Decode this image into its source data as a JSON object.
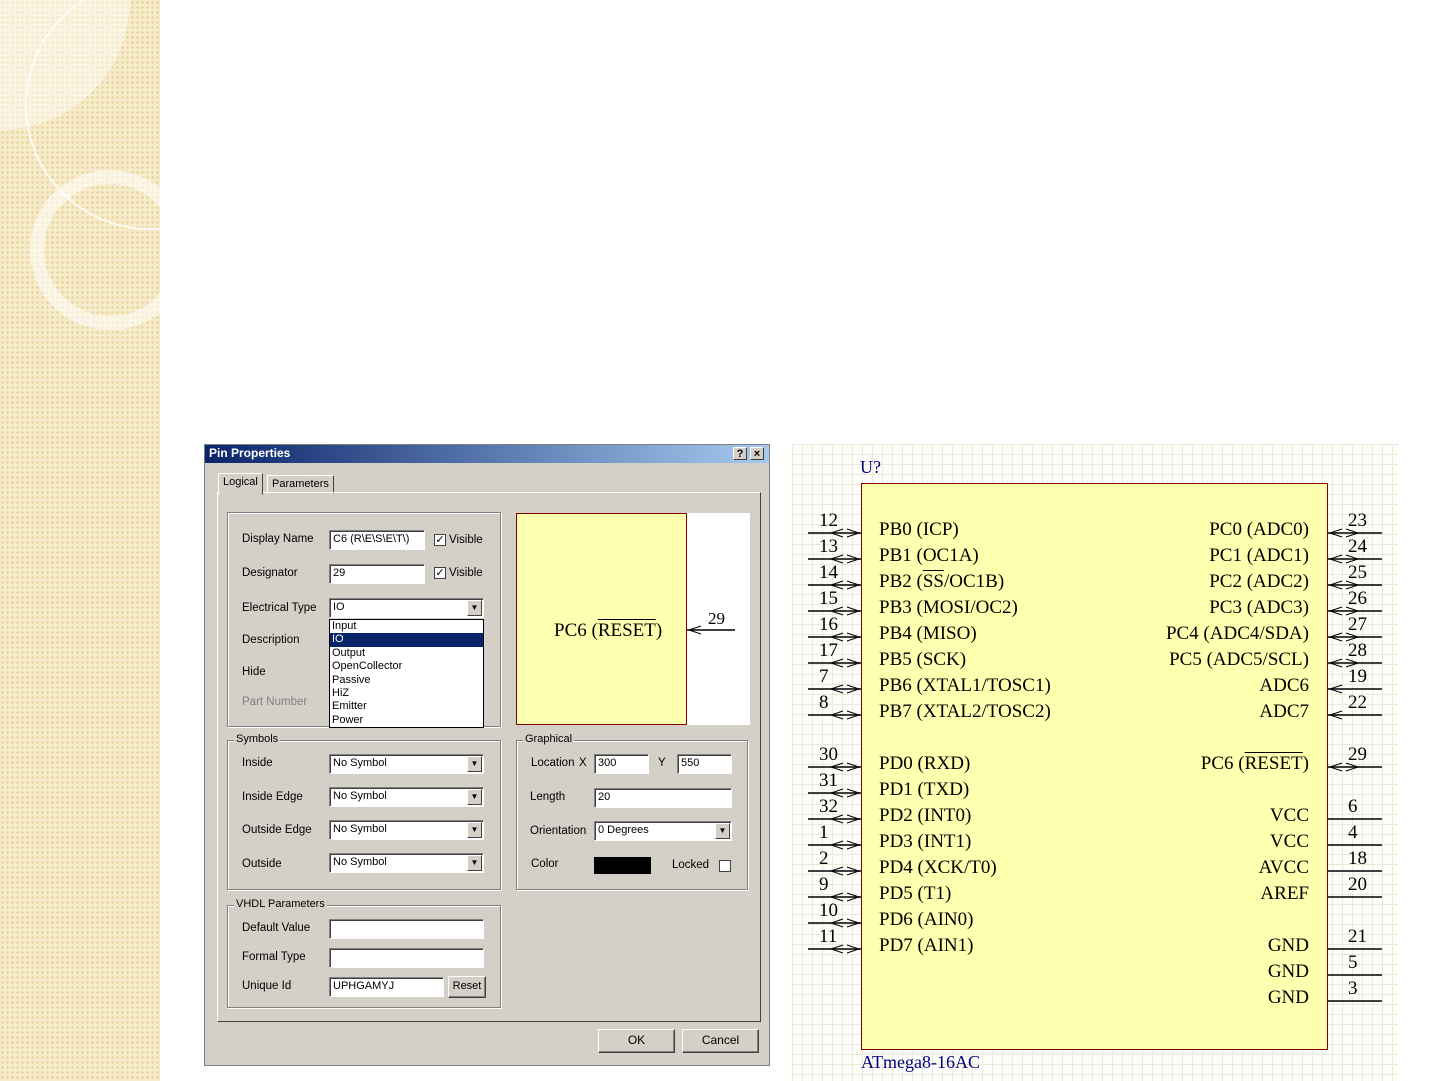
{
  "dialog": {
    "title": "Pin Properties",
    "help_glyph": "?",
    "close_glyph": "×",
    "tabs": [
      "Logical",
      "Parameters"
    ],
    "logical": {
      "display_name_label": "Display Name",
      "display_name_value": "C6 (R\\E\\S\\E\\T\\)",
      "visible_label": "Visible",
      "designator_label": "Designator",
      "designator_value": "29",
      "electrical_type_label": "Electrical Type",
      "electrical_type_value": "IO",
      "description_label": "Description",
      "hide_label": "Hide",
      "part_number_label": "Part Number",
      "electrical_type_options": [
        "Input",
        "IO",
        "Output",
        "OpenCollector",
        "Passive",
        "HiZ",
        "Emitter",
        "Power"
      ],
      "selected_option": "IO"
    },
    "preview": {
      "pin_name": "PC6 (",
      "pin_name_overline": "RESET",
      "pin_name_end": ")",
      "pin_number": "29"
    },
    "symbols": {
      "group_label": "Symbols",
      "inside_label": "Inside",
      "inside_value": "No Symbol",
      "inside_edge_label": "Inside Edge",
      "inside_edge_value": "No Symbol",
      "outside_edge_label": "Outside Edge",
      "outside_edge_value": "No Symbol",
      "outside_label": "Outside",
      "outside_value": "No Symbol"
    },
    "graphical": {
      "group_label": "Graphical",
      "location_label": "Location",
      "x_label": "X",
      "x_value": "300",
      "y_label": "Y",
      "y_value": "550",
      "length_label": "Length",
      "length_value": "20",
      "orientation_label": "Orientation",
      "orientation_value": "0 Degrees",
      "color_label": "Color",
      "color_value": "#000000",
      "locked_label": "Locked"
    },
    "vhdl": {
      "group_label": "VHDL Parameters",
      "default_value_label": "Default Value",
      "default_value": "",
      "formal_type_label": "Formal Type",
      "formal_type": "",
      "unique_id_label": "Unique Id",
      "unique_id_value": "UPHGAMYJ",
      "reset_label": "Reset"
    },
    "ok_label": "OK",
    "cancel_label": "Cancel"
  },
  "schematic": {
    "designator": "U?",
    "part_name": "ATmega8-16AC",
    "body_color": "#ffffb0",
    "left_pins": [
      {
        "num": "12",
        "name": "PB0 (ICP)"
      },
      {
        "num": "13",
        "name": "PB1 (OC1A)"
      },
      {
        "num": "14",
        "name": "PB2 (SS/OC1B)"
      },
      {
        "num": "15",
        "name": "PB3 (MOSI/OC2)"
      },
      {
        "num": "16",
        "name": "PB4 (MISO)"
      },
      {
        "num": "17",
        "name": "PB5 (SCK)"
      },
      {
        "num": "7",
        "name": "PB6 (XTAL1/TOSC1)"
      },
      {
        "num": "8",
        "name": "PB7 (XTAL2/TOSC2)"
      },
      {
        "num": "30",
        "name": "PD0 (RXD)"
      },
      {
        "num": "31",
        "name": "PD1 (TXD)"
      },
      {
        "num": "32",
        "name": "PD2 (INT0)"
      },
      {
        "num": "1",
        "name": "PD3 (INT1)"
      },
      {
        "num": "2",
        "name": "PD4 (XCK/T0)"
      },
      {
        "num": "9",
        "name": "PD5 (T1)"
      },
      {
        "num": "10",
        "name": "PD6 (AIN0)"
      },
      {
        "num": "11",
        "name": "PD7 (AIN1)"
      }
    ],
    "right_pins": [
      {
        "num": "23",
        "name": "PC0 (ADC0)"
      },
      {
        "num": "24",
        "name": "PC1 (ADC1)"
      },
      {
        "num": "25",
        "name": "PC2 (ADC2)"
      },
      {
        "num": "26",
        "name": "PC3 (ADC3)"
      },
      {
        "num": "27",
        "name": "PC4 (ADC4/SDA)"
      },
      {
        "num": "28",
        "name": "PC5 (ADC5/SCL)"
      },
      {
        "num": "19",
        "name": "ADC6"
      },
      {
        "num": "22",
        "name": "ADC7"
      },
      {
        "num": "29",
        "name": "PC6 (RESET)"
      },
      {
        "num": "6",
        "name": "VCC"
      },
      {
        "num": "4",
        "name": "VCC"
      },
      {
        "num": "18",
        "name": "AVCC"
      },
      {
        "num": "20",
        "name": "AREF"
      },
      {
        "num": "21",
        "name": "GND"
      },
      {
        "num": "5",
        "name": "GND"
      },
      {
        "num": "3",
        "name": "GND"
      }
    ]
  }
}
